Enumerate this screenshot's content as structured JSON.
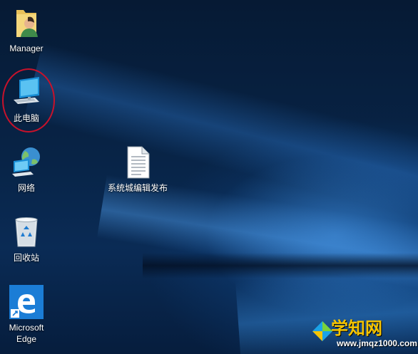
{
  "desktop": {
    "icons": [
      {
        "label": "Manager",
        "icon": "user-folder-icon"
      },
      {
        "label": "此电脑",
        "icon": "this-pc-icon"
      },
      {
        "label": "网络",
        "icon": "network-globe-icon"
      },
      {
        "label": "回收站",
        "icon": "recycle-bin-icon"
      },
      {
        "label": "Microsoft Edge",
        "icon": "edge-icon"
      },
      {
        "label": "系统城编辑发布",
        "icon": "text-file-icon"
      }
    ],
    "highlight_color": "#c7122b"
  },
  "watermark": {
    "title": "学知网",
    "url": "www.jmqz1000.com",
    "title_color": "#f5c400"
  }
}
